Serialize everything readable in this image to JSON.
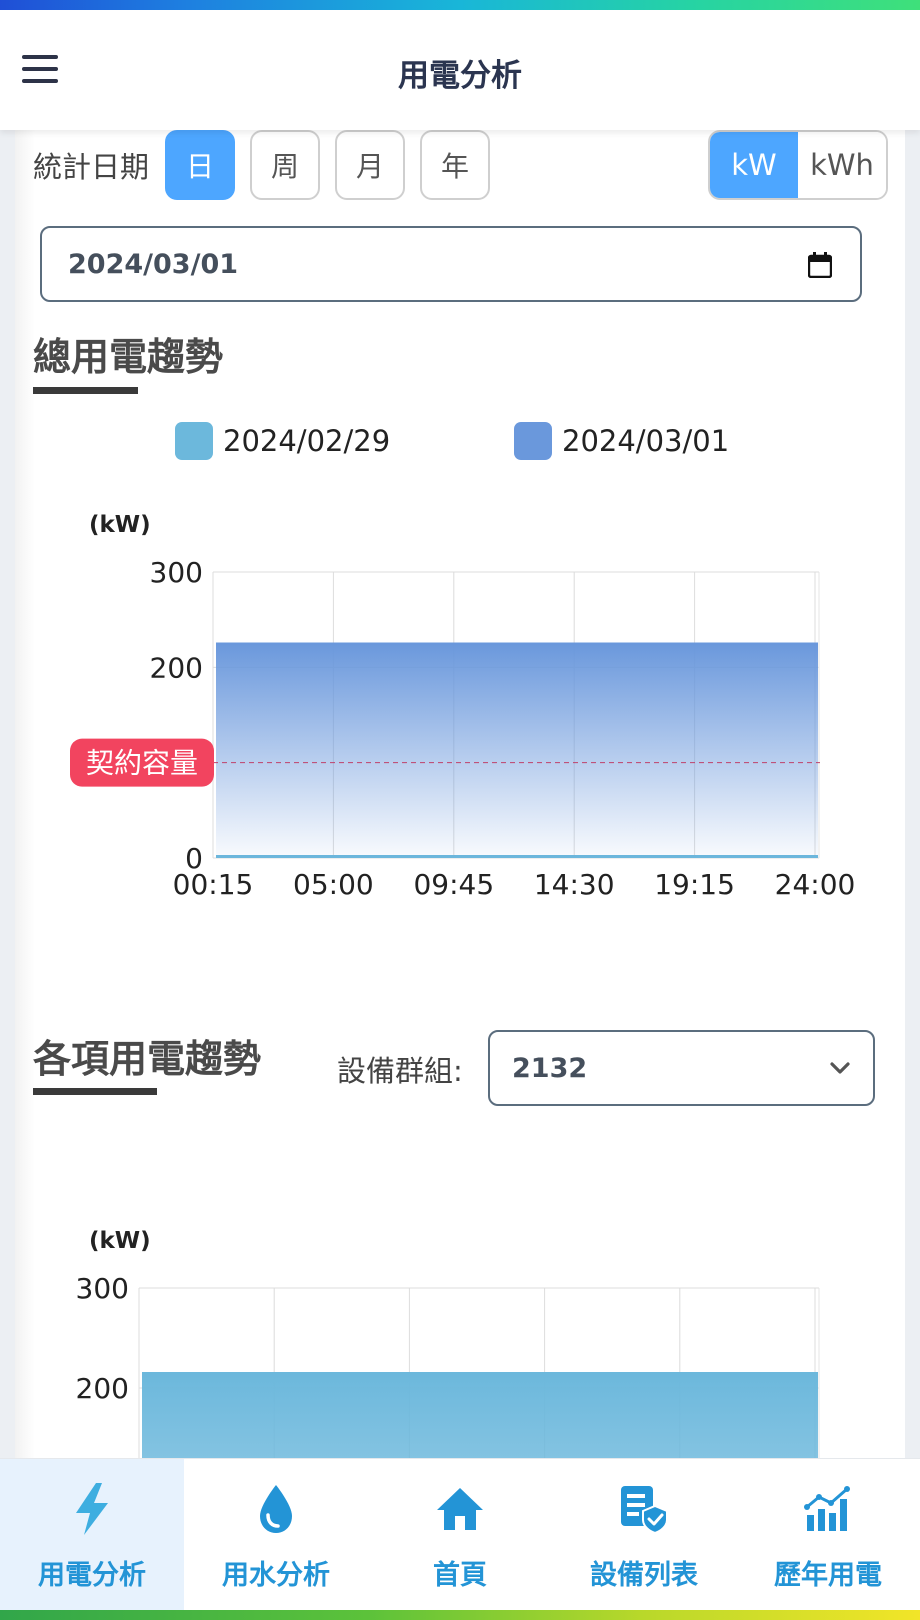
{
  "header": {
    "title": "用電分析",
    "menu_icon": "menu-icon"
  },
  "filters": {
    "stat_label": "統計日期",
    "periods": [
      {
        "label": "日",
        "active": true
      },
      {
        "label": "周",
        "active": false
      },
      {
        "label": "月",
        "active": false
      },
      {
        "label": "年",
        "active": false
      }
    ],
    "units": [
      {
        "label": "kW",
        "active": true
      },
      {
        "label": "kWh",
        "active": false
      }
    ],
    "date_value": "2024/03/01"
  },
  "total_section": {
    "title": "總用電趨勢",
    "legend": [
      {
        "label": "2024/02/29",
        "color": "#6cb8dc"
      },
      {
        "label": "2024/03/01",
        "color": "#6a98dc"
      }
    ],
    "contract_label": "契約容量"
  },
  "items_section": {
    "title": "各項用電趨勢",
    "group_label": "設備群組:",
    "group_value": "2132"
  },
  "chart_data": [
    {
      "type": "area",
      "ylabel": "(kW)",
      "ylim": [
        0,
        300
      ],
      "yticks": [
        0,
        200,
        300
      ],
      "x": [
        "00:15",
        "05:00",
        "09:45",
        "14:30",
        "19:15",
        "24:00"
      ],
      "grid": true,
      "series": [
        {
          "name": "2024/02/29",
          "color": "#6cb8dc",
          "values": [
            0,
            0,
            0,
            0,
            0,
            0
          ]
        },
        {
          "name": "2024/03/01",
          "color": "#6a98dc",
          "values": [
            225,
            225,
            225,
            225,
            225,
            225
          ]
        }
      ],
      "reference_line": {
        "label": "契約容量",
        "value": 100,
        "color": "#c0406a"
      }
    },
    {
      "type": "area",
      "ylabel": "(kW)",
      "ylim": [
        0,
        300
      ],
      "yticks": [
        200,
        300
      ],
      "grid": true,
      "series": [
        {
          "color": "#6cb8dc",
          "values": [
            215,
            215,
            215,
            215,
            215,
            215
          ]
        }
      ]
    }
  ],
  "nav": [
    {
      "label": "用電分析",
      "icon": "bolt-icon",
      "active": true
    },
    {
      "label": "用水分析",
      "icon": "water-drop-icon",
      "active": false
    },
    {
      "label": "首頁",
      "icon": "home-icon",
      "active": false
    },
    {
      "label": "設備列表",
      "icon": "device-list-icon",
      "active": false
    },
    {
      "label": "歷年用電",
      "icon": "annual-chart-icon",
      "active": false
    }
  ]
}
